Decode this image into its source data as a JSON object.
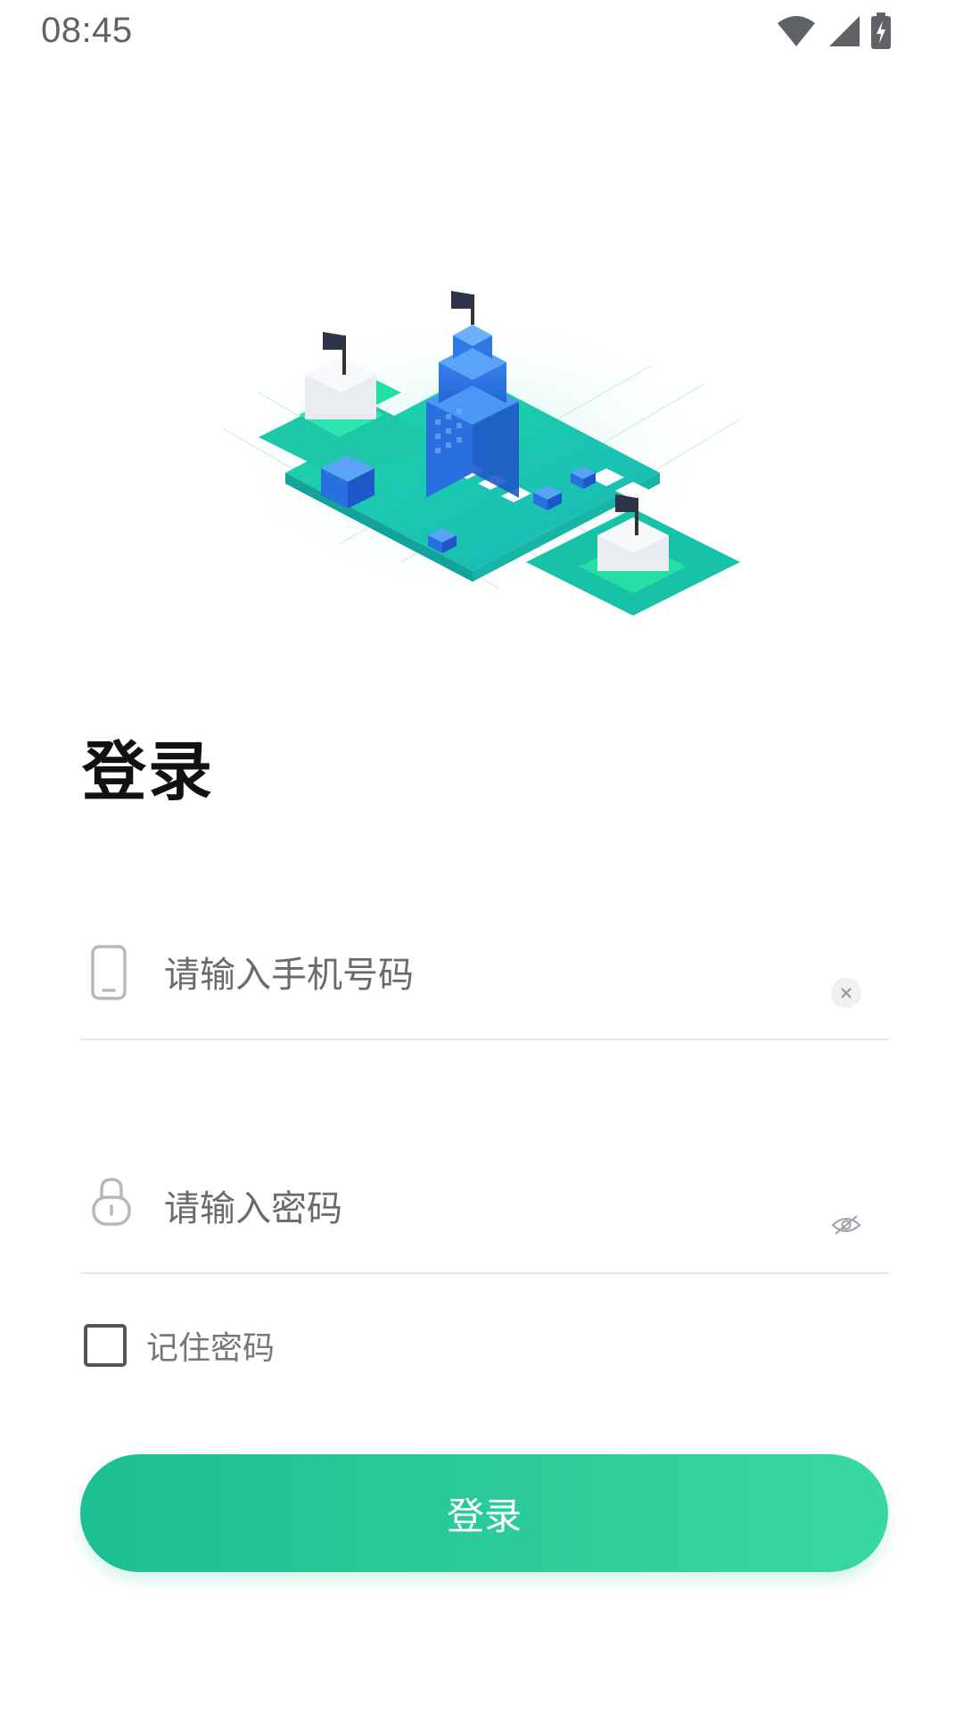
{
  "status_bar": {
    "time": "08:45",
    "icons": [
      "wifi-icon",
      "cell-signal-icon",
      "battery-charging-icon"
    ]
  },
  "hero": {
    "illustration": "isometric-city-blocks-with-flags"
  },
  "page": {
    "title": "登录"
  },
  "form": {
    "phone": {
      "placeholder": "请输入手机号码",
      "value": "",
      "leading_icon": "phone-icon",
      "trailing_icon": "clear-icon"
    },
    "password": {
      "placeholder": "请输入密码",
      "value": "",
      "leading_icon": "lock-icon",
      "trailing_icon": "eye-off-icon"
    },
    "remember": {
      "label": "记住密码",
      "checked": false
    },
    "submit_label": "登录"
  },
  "colors": {
    "accent_start": "#1bbf93",
    "accent_end": "#3ad7a0",
    "title": "#111111",
    "placeholder": "#6b6b6b",
    "divider": "#e6e6e6"
  }
}
